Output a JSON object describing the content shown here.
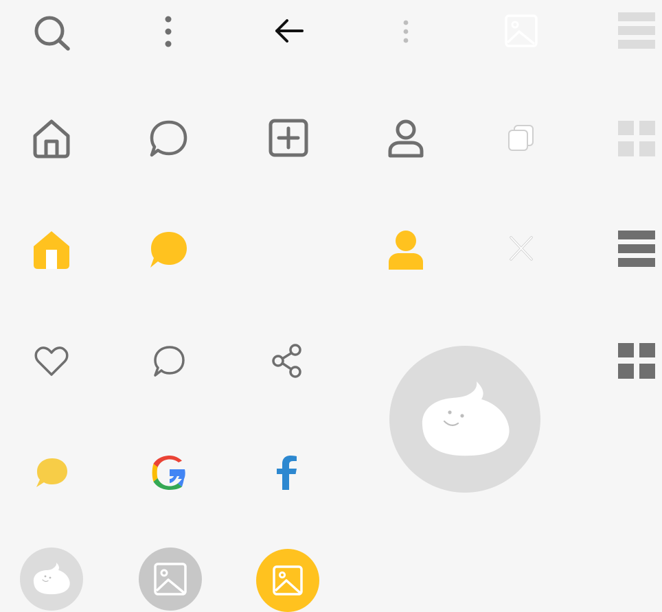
{
  "colors": {
    "background": "#f6f6f6",
    "icon_gray": "#6f6f6f",
    "icon_dark": "#111111",
    "icon_light": "#bdbdbd",
    "icon_faint": "#dcdcdc",
    "accent_yellow": "#ffc21f",
    "speech_yellow": "#f7cd47",
    "avatar_bg": "#dcdcdc",
    "image_bg_gray": "#c7c7c7",
    "facebook_blue": "#2d88d0",
    "google_blue": "#4285f4",
    "google_red": "#ea4335",
    "google_yellow": "#fbbc05",
    "google_green": "#34a853"
  },
  "icons": [
    "search-icon",
    "more-vertical-icon",
    "arrow-left-icon",
    "more-vertical-light-icon",
    "image-placeholder-icon",
    "list-view-light-icon",
    "home-outline-icon",
    "chat-bubble-outline-icon",
    "add-square-icon",
    "person-outline-icon",
    "copy-icon",
    "grid-view-light-icon",
    "home-filled-icon",
    "chat-bubble-filled-icon",
    "person-filled-icon",
    "close-icon",
    "list-view-icon",
    "heart-outline-icon",
    "comment-outline-icon",
    "share-icon",
    "grid-view-icon",
    "kakao-talk-icon",
    "google-logo-icon",
    "facebook-logo-icon",
    "default-avatar-large-icon",
    "default-avatar-small-icon",
    "image-button-gray-icon",
    "image-button-yellow-icon"
  ]
}
